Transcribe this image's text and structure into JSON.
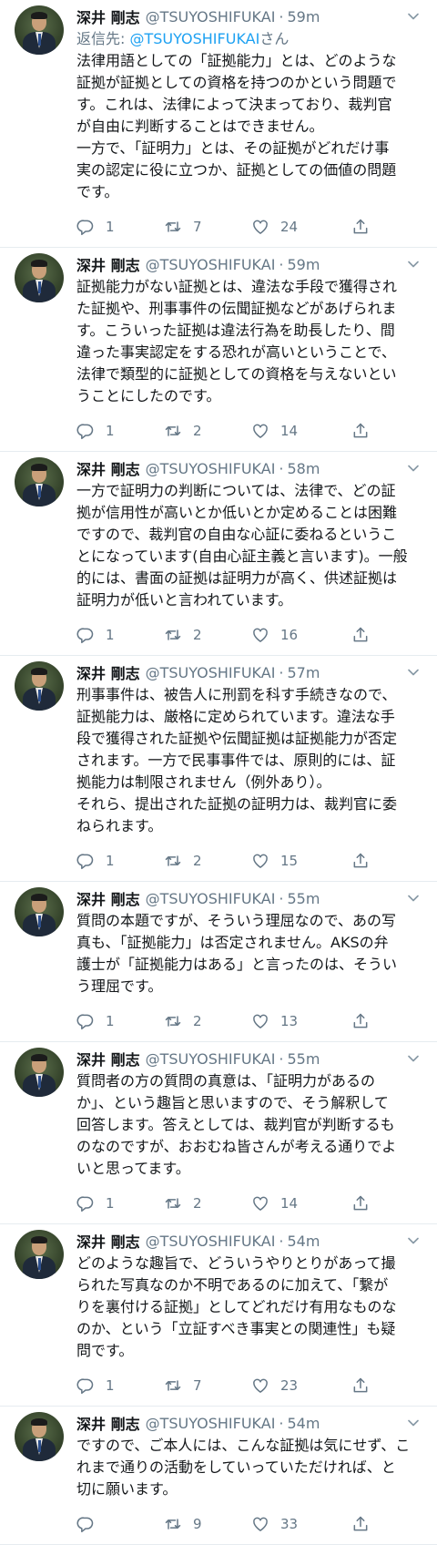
{
  "tweets": [
    {
      "name": "深井 剛志",
      "handle": "@TSUYOSHIFUKAI",
      "dot": "·",
      "time": "59m",
      "reply_prefix": "返信先: ",
      "reply_mention": "@TSUYOSHIFUKAI",
      "reply_suffix": "さん",
      "text": "法律用語としての「証拠能力」とは、どのような\n証拠が証拠としての資格を持つのかという問題で\nす。これは、法律によって決まっており、裁判官\nが自由に判断することはできません。\n一方で、「証明力」とは、その証拠がどれだけ事\n実の認定に役に立つか、証拠としての価値の問題\nです。",
      "replies": "1",
      "retweets": "7",
      "likes": "24"
    },
    {
      "name": "深井 剛志",
      "handle": "@TSUYOSHIFUKAI",
      "dot": "·",
      "time": "59m",
      "text": "証拠能力がない証拠とは、違法な手段で獲得され\nた証拠や、刑事事件の伝聞証拠などがあげられま\nす。こういった証拠は違法行為を助長したり、間\n違った事実認定をする恐れが高いということで、\n法律で類型的に証拠としての資格を与えないとい\nうことにしたのです。",
      "replies": "1",
      "retweets": "2",
      "likes": "14"
    },
    {
      "name": "深井 剛志",
      "handle": "@TSUYOSHIFUKAI",
      "dot": "·",
      "time": "58m",
      "text": "一方で証明力の判断については、法律で、どの証\n拠が信用性が高いとか低いとか定めることは困難\nですので、裁判官の自由な心証に委ねるというこ\nとになっています(自由心証主義と言います)。一般\n的には、書面の証拠は証明力が高く、供述証拠は\n証明力が低いと言われています。",
      "replies": "1",
      "retweets": "2",
      "likes": "16"
    },
    {
      "name": "深井 剛志",
      "handle": "@TSUYOSHIFUKAI",
      "dot": "·",
      "time": "57m",
      "text": "刑事事件は、被告人に刑罰を科す手続きなので、\n証拠能力は、厳格に定められています。違法な手\n段で獲得された証拠や伝聞証拠は証拠能力が否定\nされます。一方で民事事件では、原則的には、証\n拠能力は制限されません（例外あり）。\nそれら、提出された証拠の証明力は、裁判官に委\nねられます。",
      "replies": "1",
      "retweets": "2",
      "likes": "15"
    },
    {
      "name": "深井 剛志",
      "handle": "@TSUYOSHIFUKAI",
      "dot": "·",
      "time": "55m",
      "text": "質問の本題ですが、そういう理屈なので、あの写\n真も、「証拠能力」は否定されません。AKSの弁\n護士が「証拠能力はある」と言ったのは、そうい\nう理屈です。",
      "replies": "1",
      "retweets": "2",
      "likes": "13"
    },
    {
      "name": "深井 剛志",
      "handle": "@TSUYOSHIFUKAI",
      "dot": "·",
      "time": "55m",
      "text": "質問者の方の質問の真意は、「証明力があるの\nか」、という趣旨と思いますので、そう解釈して\n回答します。答えとしては、裁判官が判断するも\nのなのですが、おおむね皆さんが考える通りでよ\nいと思ってます。",
      "replies": "1",
      "retweets": "2",
      "likes": "14"
    },
    {
      "name": "深井 剛志",
      "handle": "@TSUYOSHIFUKAI",
      "dot": "·",
      "time": "54m",
      "text": "どのような趣旨で、どういうやりとりがあって撮\nられた写真なのか不明であるのに加えて、「繋が\nりを裏付ける証拠」としてどれだけ有用なものな\nのか、という「立証すべき事実との関連性」も疑\n問です。",
      "replies": "1",
      "retweets": "7",
      "likes": "23"
    },
    {
      "name": "深井 剛志",
      "handle": "@TSUYOSHIFUKAI",
      "dot": "·",
      "time": "54m",
      "text": "ですので、ご本人には、こんな証拠は気にせず、こ\nれまで通りの活動をしていっていただければ、と\n切に願います。",
      "replies": "",
      "retweets": "9",
      "likes": "33"
    }
  ]
}
